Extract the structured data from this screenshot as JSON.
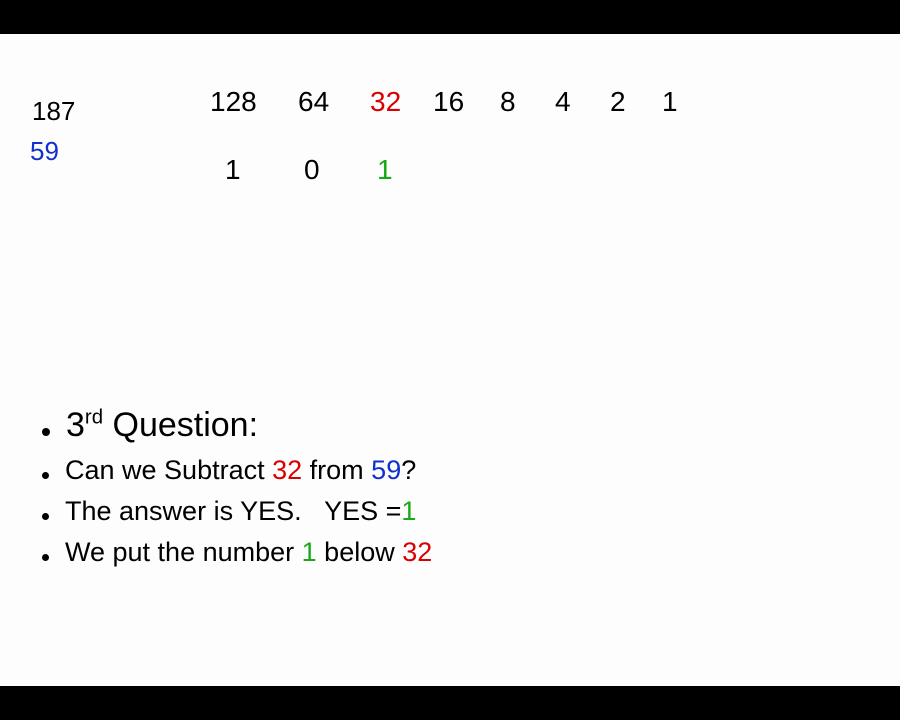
{
  "colors": {
    "red": "#d80000",
    "blue": "#1030cc",
    "green": "#18a818",
    "black": "#000000"
  },
  "top_numbers": {
    "total": "187",
    "remainder": "59"
  },
  "place_values": {
    "c128": "128",
    "c64": "64",
    "c32": "32",
    "c16": "16",
    "c8": "8",
    "c4": "4",
    "c2": "2",
    "c1": "1"
  },
  "binary_digits": {
    "c128": "1",
    "c64": "0",
    "c32": "1"
  },
  "bullets": {
    "q": {
      "prefix": "3",
      "ord": "rd",
      "rest": " Question:"
    },
    "l1": {
      "a": "Can we Subtract ",
      "b": "32",
      "c": " from ",
      "d": "59",
      "e": "?"
    },
    "l2": {
      "a": "The answer is YES.   YES =",
      "b": "1"
    },
    "l3": {
      "a": "We put the number ",
      "b": "1",
      "c": " below ",
      "d": "32"
    }
  }
}
